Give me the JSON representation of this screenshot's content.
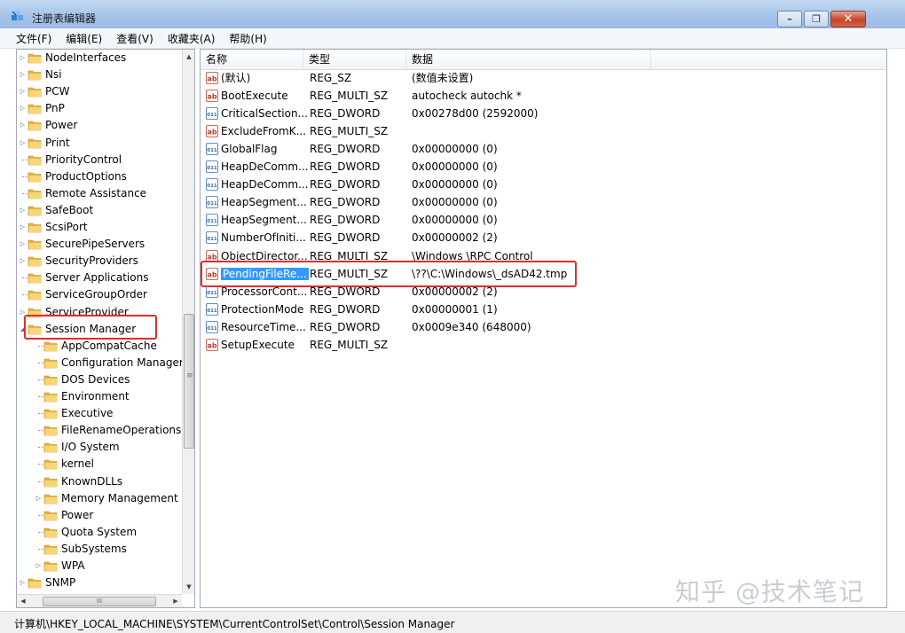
{
  "window": {
    "title": "注册表编辑器",
    "min_glyph": "–",
    "max_glyph": "❐",
    "close_glyph": "✕"
  },
  "menu": [
    "文件(F)",
    "编辑(E)",
    "查看(V)",
    "收藏夹(A)",
    "帮助(H)"
  ],
  "tree": {
    "items": [
      {
        "label": "NodeInterfaces",
        "expander": "▷",
        "depth": 0
      },
      {
        "label": "Nsi",
        "expander": "▷",
        "depth": 0
      },
      {
        "label": "PCW",
        "expander": "▷",
        "depth": 0
      },
      {
        "label": "PnP",
        "expander": "▷",
        "depth": 0
      },
      {
        "label": "Power",
        "expander": "▷",
        "depth": 0
      },
      {
        "label": "Print",
        "expander": "▷",
        "depth": 0
      },
      {
        "label": "PriorityControl",
        "expander": "",
        "depth": 0
      },
      {
        "label": "ProductOptions",
        "expander": "",
        "depth": 0
      },
      {
        "label": "Remote Assistance",
        "expander": "",
        "depth": 0
      },
      {
        "label": "SafeBoot",
        "expander": "▷",
        "depth": 0
      },
      {
        "label": "ScsiPort",
        "expander": "▷",
        "depth": 0
      },
      {
        "label": "SecurePipeServers",
        "expander": "▷",
        "depth": 0
      },
      {
        "label": "SecurityProviders",
        "expander": "▷",
        "depth": 0
      },
      {
        "label": "Server Applications",
        "expander": "",
        "depth": 0
      },
      {
        "label": "ServiceGroupOrder",
        "expander": "",
        "depth": 0
      },
      {
        "label": "ServiceProvider",
        "expander": "▷",
        "depth": 0
      },
      {
        "label": "Session Manager",
        "expander": "◢",
        "depth": 0,
        "selected": true
      },
      {
        "label": "AppCompatCache",
        "expander": "",
        "depth": 1
      },
      {
        "label": "Configuration Manager",
        "expander": "",
        "depth": 1
      },
      {
        "label": "DOS Devices",
        "expander": "",
        "depth": 1
      },
      {
        "label": "Environment",
        "expander": "",
        "depth": 1
      },
      {
        "label": "Executive",
        "expander": "",
        "depth": 1
      },
      {
        "label": "FileRenameOperations",
        "expander": "",
        "depth": 1
      },
      {
        "label": "I/O System",
        "expander": "",
        "depth": 1
      },
      {
        "label": "kernel",
        "expander": "",
        "depth": 1
      },
      {
        "label": "KnownDLLs",
        "expander": "",
        "depth": 1
      },
      {
        "label": "Memory Management",
        "expander": "▷",
        "depth": 1
      },
      {
        "label": "Power",
        "expander": "",
        "depth": 1
      },
      {
        "label": "Quota System",
        "expander": "",
        "depth": 1
      },
      {
        "label": "SubSystems",
        "expander": "",
        "depth": 1
      },
      {
        "label": "WPA",
        "expander": "▷",
        "depth": 1
      },
      {
        "label": "SNMP",
        "expander": "▷",
        "depth": 0
      }
    ],
    "scroll_up": "▲",
    "scroll_down": "▼",
    "scroll_left": "◀",
    "scroll_right": "▶",
    "scroll_grip": "≡",
    "hscroll_grip": "III"
  },
  "list": {
    "columns": [
      "名称",
      "类型",
      "数据"
    ],
    "rows": [
      {
        "icon": "string",
        "name": "(默认)",
        "type": "REG_SZ",
        "data": "(数值未设置)"
      },
      {
        "icon": "string",
        "name": "BootExecute",
        "type": "REG_MULTI_SZ",
        "data": "autocheck autochk *"
      },
      {
        "icon": "dword",
        "name": "CriticalSection...",
        "type": "REG_DWORD",
        "data": "0x00278d00 (2592000)"
      },
      {
        "icon": "string",
        "name": "ExcludeFromK...",
        "type": "REG_MULTI_SZ",
        "data": ""
      },
      {
        "icon": "dword",
        "name": "GlobalFlag",
        "type": "REG_DWORD",
        "data": "0x00000000 (0)"
      },
      {
        "icon": "dword",
        "name": "HeapDeComm...",
        "type": "REG_DWORD",
        "data": "0x00000000 (0)"
      },
      {
        "icon": "dword",
        "name": "HeapDeComm...",
        "type": "REG_DWORD",
        "data": "0x00000000 (0)"
      },
      {
        "icon": "dword",
        "name": "HeapSegment...",
        "type": "REG_DWORD",
        "data": "0x00000000 (0)"
      },
      {
        "icon": "dword",
        "name": "HeapSegment...",
        "type": "REG_DWORD",
        "data": "0x00000000 (0)"
      },
      {
        "icon": "dword",
        "name": "NumberOfIniti...",
        "type": "REG_DWORD",
        "data": "0x00000002 (2)"
      },
      {
        "icon": "string",
        "name": "ObjectDirector...",
        "type": "REG_MULTI_SZ",
        "data": "\\Windows \\RPC Control"
      },
      {
        "icon": "string",
        "name": "PendingFileRe...",
        "type": "REG_MULTI_SZ",
        "data": "\\??\\C:\\Windows\\_dsAD42.tmp",
        "selected": true
      },
      {
        "icon": "dword",
        "name": "ProcessorCont...",
        "type": "REG_DWORD",
        "data": "0x00000002 (2)"
      },
      {
        "icon": "dword",
        "name": "ProtectionMode",
        "type": "REG_DWORD",
        "data": "0x00000001 (1)"
      },
      {
        "icon": "dword",
        "name": "ResourceTime...",
        "type": "REG_DWORD",
        "data": "0x0009e340 (648000)"
      },
      {
        "icon": "string",
        "name": "SetupExecute",
        "type": "REG_MULTI_SZ",
        "data": ""
      }
    ]
  },
  "status": {
    "path": "计算机\\HKEY_LOCAL_MACHINE\\SYSTEM\\CurrentControlSet\\Control\\Session Manager"
  },
  "watermark": "知乎 @技术笔记",
  "colors": {
    "selection": "#3399ff",
    "highlight_box": "#e32b2b",
    "folder": "#e8b33c"
  }
}
